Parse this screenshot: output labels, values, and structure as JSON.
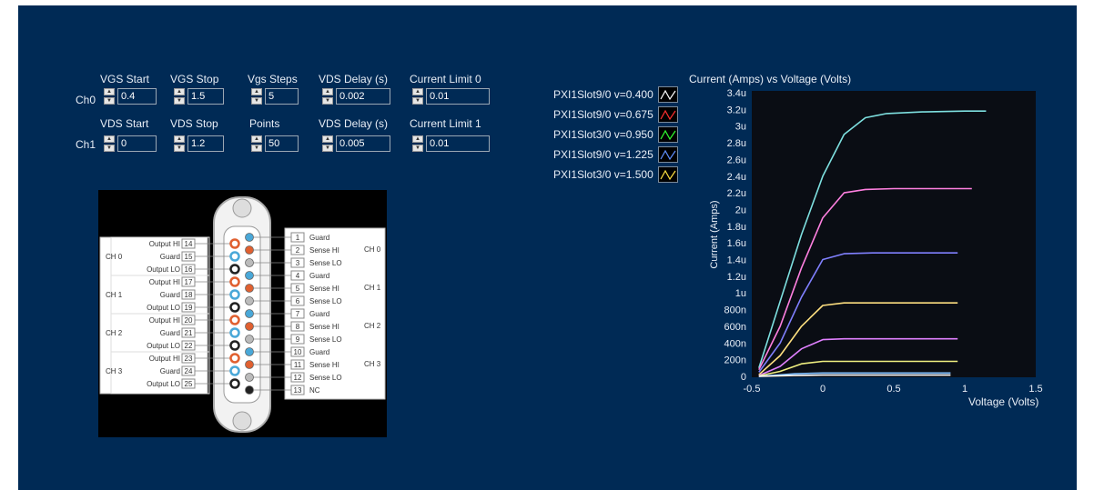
{
  "controls": {
    "row0": {
      "channel": "Ch0",
      "items": [
        {
          "label": "VGS Start",
          "value": "0.4"
        },
        {
          "label": "VGS Stop",
          "value": "1.5"
        },
        {
          "label": "Vgs Steps",
          "value": "5"
        },
        {
          "label": "VDS Delay (s)",
          "value": "0.002"
        },
        {
          "label": "Current Limit 0",
          "value": "0.01"
        }
      ]
    },
    "row1": {
      "channel": "Ch1",
      "items": [
        {
          "label": "VDS Start",
          "value": "0"
        },
        {
          "label": "VDS Stop",
          "value": "1.2"
        },
        {
          "label": "Points",
          "value": "50"
        },
        {
          "label": "VDS Delay (s)",
          "value": "0.005"
        },
        {
          "label": "Current Limit 1",
          "value": "0.01"
        }
      ]
    }
  },
  "pinout": {
    "left_pins": [
      {
        "num": "14",
        "label": "Output HI"
      },
      {
        "num": "15",
        "label": "Guard"
      },
      {
        "num": "16",
        "label": "Output LO"
      },
      {
        "num": "17",
        "label": "Output HI"
      },
      {
        "num": "18",
        "label": "Guard"
      },
      {
        "num": "19",
        "label": "Output LO"
      },
      {
        "num": "20",
        "label": "Output HI"
      },
      {
        "num": "21",
        "label": "Guard"
      },
      {
        "num": "22",
        "label": "Output LO"
      },
      {
        "num": "23",
        "label": "Output HI"
      },
      {
        "num": "24",
        "label": "Guard"
      },
      {
        "num": "25",
        "label": "Output LO"
      }
    ],
    "right_pins": [
      {
        "num": "1",
        "label": "Guard"
      },
      {
        "num": "2",
        "label": "Sense HI"
      },
      {
        "num": "3",
        "label": "Sense LO"
      },
      {
        "num": "4",
        "label": "Guard"
      },
      {
        "num": "5",
        "label": "Sense HI"
      },
      {
        "num": "6",
        "label": "Sense LO"
      },
      {
        "num": "7",
        "label": "Guard"
      },
      {
        "num": "8",
        "label": "Sense HI"
      },
      {
        "num": "9",
        "label": "Sense LO"
      },
      {
        "num": "10",
        "label": "Guard"
      },
      {
        "num": "11",
        "label": "Sense HI"
      },
      {
        "num": "12",
        "label": "Sense LO"
      },
      {
        "num": "13",
        "label": "NC"
      }
    ],
    "left_channels": [
      "CH 0",
      "CH 1",
      "CH 2",
      "CH 3"
    ],
    "right_channels": [
      "CH 0",
      "CH 1",
      "CH 2",
      "CH 3"
    ],
    "colors": {
      "guard": "#4aa8d8",
      "hi": "#e06030",
      "lo": "#222222",
      "sense_lo": "#bbbbbb"
    }
  },
  "legend": [
    {
      "label": "PXI1Slot9/0 v=0.400",
      "color": "#ffffff"
    },
    {
      "label": "PXI1Slot9/0 v=0.675",
      "color": "#ff3030"
    },
    {
      "label": "PXI1Slot3/0 v=0.950",
      "color": "#30ff30"
    },
    {
      "label": "PXI1Slot9/0 v=1.225",
      "color": "#6090ff"
    },
    {
      "label": "PXI1Slot3/0 v=1.500",
      "color": "#ffe040"
    }
  ],
  "chart_data": {
    "type": "line",
    "title": "Current (Amps) vs Voltage (Volts)",
    "xlabel": "Voltage (Volts)",
    "ylabel": "Current (Amps)",
    "xlim": [
      -0.5,
      1.5
    ],
    "ylim": [
      0,
      3.4e-06
    ],
    "xticks": [
      "-0.5",
      "0",
      "0.5",
      "1",
      "1.5"
    ],
    "yticks": [
      "0",
      "200n",
      "400n",
      "600n",
      "800n",
      "1u",
      "1.2u",
      "1.4u",
      "1.6u",
      "1.8u",
      "2u",
      "2.2u",
      "2.4u",
      "2.6u",
      "2.8u",
      "3u",
      "3.2u",
      "3.4u"
    ],
    "series": [
      {
        "color": "#7ee0e0",
        "x": [
          -0.45,
          -0.3,
          -0.15,
          0,
          0.15,
          0.3,
          0.45,
          0.7,
          1.0,
          1.15
        ],
        "values": [
          1e-07,
          9e-07,
          1.7e-06,
          2.4e-06,
          2.9e-06,
          3.1e-06,
          3.15e-06,
          3.17e-06,
          3.18e-06,
          3.18e-06
        ]
      },
      {
        "color": "#ff80e0",
        "x": [
          -0.45,
          -0.3,
          -0.15,
          0,
          0.15,
          0.3,
          0.5,
          0.8,
          1.05
        ],
        "values": [
          8e-08,
          6e-07,
          1.3e-06,
          1.9e-06,
          2.2e-06,
          2.24e-06,
          2.25e-06,
          2.25e-06,
          2.25e-06
        ]
      },
      {
        "color": "#8080ff",
        "x": [
          -0.45,
          -0.3,
          -0.15,
          0,
          0.15,
          0.35,
          0.6,
          0.95
        ],
        "values": [
          5e-08,
          4e-07,
          9.5e-07,
          1.4e-06,
          1.47e-06,
          1.48e-06,
          1.48e-06,
          1.48e-06
        ]
      },
      {
        "color": "#ffe080",
        "x": [
          -0.45,
          -0.3,
          -0.15,
          0,
          0.15,
          0.35,
          0.6,
          0.95
        ],
        "values": [
          2e-08,
          2.5e-07,
          6e-07,
          8.5e-07,
          8.8e-07,
          8.8e-07,
          8.8e-07,
          8.8e-07
        ]
      },
      {
        "color": "#e080ff",
        "x": [
          -0.45,
          -0.3,
          -0.15,
          0,
          0.15,
          0.35,
          0.6,
          0.95
        ],
        "values": [
          1e-08,
          1.2e-07,
          3.3e-07,
          4.4e-07,
          4.5e-07,
          4.5e-07,
          4.5e-07,
          4.5e-07
        ]
      },
      {
        "color": "#f0f080",
        "x": [
          -0.45,
          -0.3,
          -0.15,
          0,
          0.2,
          0.5,
          0.95
        ],
        "values": [
          5e-09,
          6e-08,
          1.5e-07,
          1.8e-07,
          1.8e-07,
          1.8e-07,
          1.8e-07
        ]
      },
      {
        "color": "#80c0ff",
        "x": [
          -0.45,
          -0.2,
          0,
          0.5,
          0.9
        ],
        "values": [
          0.0,
          3e-08,
          4e-08,
          4e-08,
          4e-08
        ]
      },
      {
        "color": "#ffffff",
        "x": [
          -0.45,
          -0.2,
          0,
          0.5,
          0.9
        ],
        "values": [
          0.0,
          1e-08,
          1.5e-08,
          1.5e-08,
          1.5e-08
        ]
      }
    ]
  }
}
